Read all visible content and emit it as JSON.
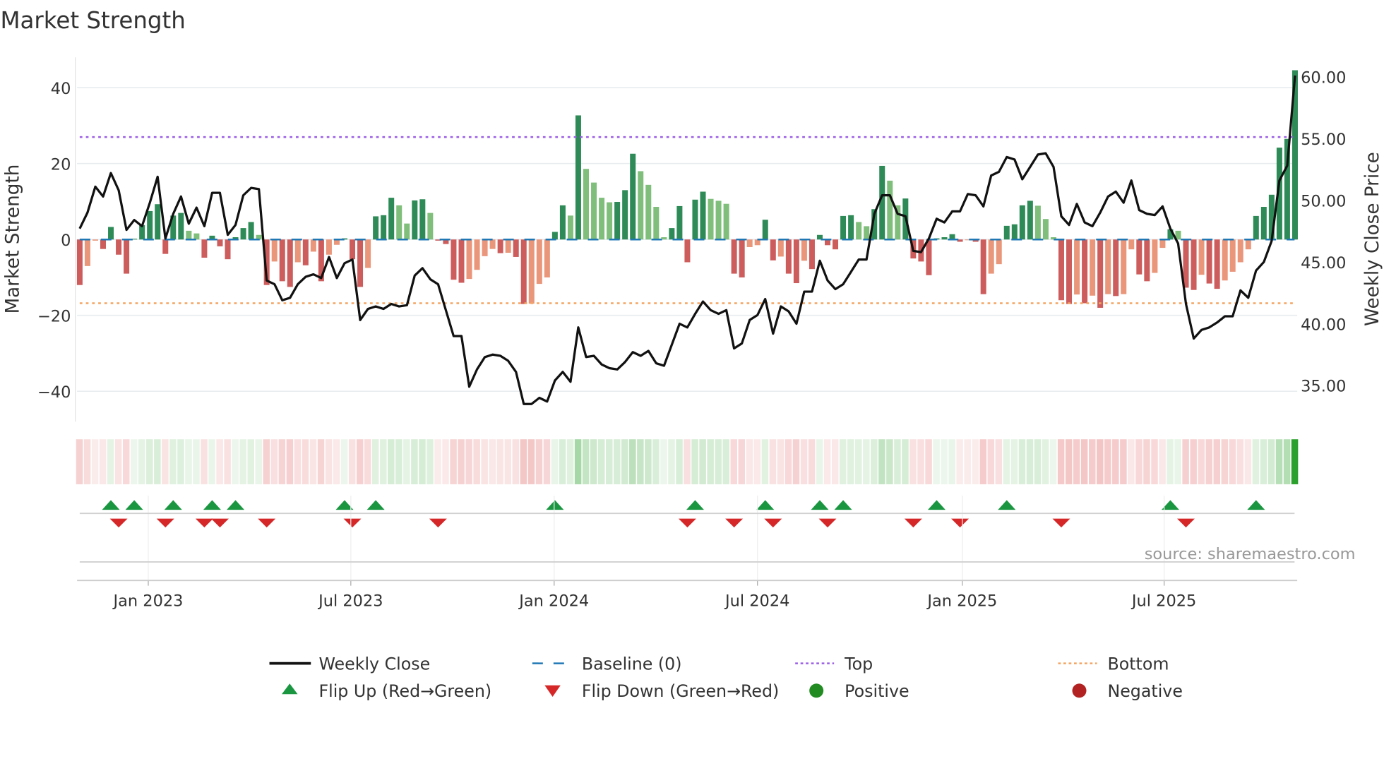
{
  "chart_data": {
    "type": "bar",
    "title": "Market Strength",
    "ylabel": "Market Strength",
    "ylabel_right": "Weekly Close Price",
    "ylim": [
      -48,
      48
    ],
    "ylim_right": [
      32.07,
      61.57
    ],
    "yticks": [
      {
        "value": 40,
        "label": "40"
      },
      {
        "value": 20,
        "label": "20"
      },
      {
        "value": 0,
        "label": "0"
      },
      {
        "value": -20,
        "label": "−20"
      },
      {
        "value": -40,
        "label": "−40"
      }
    ],
    "yticks_right": [
      {
        "value": 60,
        "label": "60.00"
      },
      {
        "value": 55,
        "label": "55.00"
      },
      {
        "value": 50,
        "label": "50.00"
      },
      {
        "value": 45,
        "label": "45.00"
      },
      {
        "value": 40,
        "label": "40.00"
      },
      {
        "value": 35,
        "label": "35.00"
      }
    ],
    "x_unit": "week index",
    "xticks": [
      {
        "week": 8.8,
        "label": "Jan 2023"
      },
      {
        "week": 34.8,
        "label": "Jul 2023"
      },
      {
        "week": 60.9,
        "label": "Jan 2024"
      },
      {
        "week": 87.0,
        "label": "Jul 2024"
      },
      {
        "week": 113.3,
        "label": "Jan 2025"
      },
      {
        "week": 139.2,
        "label": "Jul 2025"
      }
    ],
    "top_level": 27,
    "bottom_level": -16.8,
    "baseline": 0,
    "strength": [
      -12,
      -7,
      -0.3,
      -2.5,
      3.3,
      -4,
      -9,
      0.2,
      3.8,
      7.5,
      9.3,
      -3.8,
      6.3,
      7,
      2.3,
      1.6,
      -4.8,
      1,
      -1.8,
      -5.2,
      0.6,
      3,
      4.6,
      1.2,
      -12,
      -5.8,
      -11,
      -12.5,
      -6,
      -6.8,
      -3.2,
      -11,
      -4,
      -1.4,
      0.3,
      -5.2,
      -12.5,
      -7.5,
      6.1,
      6.4,
      11,
      9,
      4.2,
      10.3,
      10.6,
      7,
      -0.3,
      -1.2,
      -10.6,
      -11.4,
      -10.4,
      -8,
      -4.4,
      -2.5,
      -3.6,
      -3.5,
      -4.6,
      -17,
      -16.9,
      -11.7,
      -10,
      2,
      9,
      6.3,
      32.7,
      18.6,
      15,
      11,
      9.8,
      9.9,
      13,
      22.6,
      18,
      14.4,
      8.6,
      0.6,
      3,
      8.8,
      -6,
      10.5,
      12.6,
      10.7,
      10.2,
      9.4,
      -9,
      -10,
      -2,
      -1.5,
      5.2,
      -5.5,
      -4.5,
      -9,
      -11.5,
      -5.6,
      -7.8,
      1.2,
      -1.5,
      -2.6,
      6.2,
      6.4,
      4.6,
      3.5,
      8,
      19.4,
      15.5,
      9,
      10.8,
      -5,
      -5.8,
      -9.4,
      0.3,
      0.6,
      1.4,
      -0.6,
      -0.2,
      -0.6,
      -14.4,
      -9,
      -6.5,
      3.6,
      4,
      9,
      10.2,
      8.9,
      5.4,
      0.6,
      -16,
      -17,
      -14.5,
      -16.8,
      -14.8,
      -18,
      -14.4,
      -14.9,
      -14.4,
      -2.6,
      -9.2,
      -11,
      -8.8,
      -2.2,
      2.7,
      2.3,
      -12.7,
      -13.3,
      -9.3,
      -11.6,
      -13,
      -10.8,
      -8.5,
      -6,
      -2.6,
      6.2,
      8.6,
      11.8,
      24.2,
      26.5,
      44.6
    ],
    "weekly_close": [
      47.7,
      49.0,
      51.1,
      50.3,
      52.2,
      50.8,
      47.6,
      48.4,
      47.9,
      49.8,
      51.9,
      46.9,
      48.9,
      50.3,
      48.1,
      49.4,
      47.9,
      50.6,
      50.6,
      47.2,
      48.0,
      50.4,
      51.0,
      50.9,
      43.5,
      43.2,
      41.9,
      42.1,
      43.2,
      43.8,
      44.0,
      43.7,
      45.4,
      43.7,
      44.9,
      45.2,
      40.3,
      41.2,
      41.4,
      41.2,
      41.6,
      41.4,
      41.5,
      43.9,
      44.5,
      43.6,
      43.2,
      41.1,
      39.0,
      39.0,
      34.9,
      36.3,
      37.3,
      37.5,
      37.4,
      37.0,
      36.1,
      33.5,
      33.5,
      34.0,
      33.7,
      35.4,
      36.1,
      35.3,
      39.7,
      37.3,
      37.4,
      36.7,
      36.4,
      36.3,
      36.9,
      37.7,
      37.4,
      37.8,
      36.8,
      36.6,
      38.3,
      40.0,
      39.7,
      40.8,
      41.8,
      41.1,
      40.8,
      41.1,
      38.0,
      38.4,
      40.3,
      40.7,
      42.0,
      39.2,
      41.4,
      41.0,
      40.0,
      42.6,
      42.6,
      45.1,
      43.5,
      42.8,
      43.2,
      44.2,
      45.2,
      45.2,
      48.9,
      50.4,
      50.4,
      48.9,
      48.7,
      45.9,
      45.8,
      46.9,
      48.5,
      48.2,
      49.1,
      49.1,
      50.5,
      50.4,
      49.5,
      52.0,
      52.3,
      53.5,
      53.3,
      51.7,
      52.7,
      53.7,
      53.8,
      52.7,
      48.7,
      48.0,
      49.7,
      48.2,
      47.9,
      49.0,
      50.3,
      50.7,
      49.8,
      51.6,
      49.2,
      48.9,
      48.8,
      49.5,
      47.7,
      46.5,
      41.6,
      38.8,
      39.5,
      39.7,
      40.1,
      40.6,
      40.6,
      42.7,
      42.1,
      44.3,
      45.0,
      46.7,
      51.6,
      52.8,
      60.1
    ],
    "legend": [
      {
        "key": "close",
        "label": "Weekly Close"
      },
      {
        "key": "baseline",
        "label": "Baseline (0)"
      },
      {
        "key": "top",
        "label": "Top"
      },
      {
        "key": "bottom",
        "label": "Bottom"
      },
      {
        "key": "flip_up",
        "label": "Flip Up (Red→Green)"
      },
      {
        "key": "flip_down",
        "label": "Flip Down (Green→Red)"
      },
      {
        "key": "positive",
        "label": "Positive"
      },
      {
        "key": "negative",
        "label": "Negative"
      }
    ],
    "legend_placement": "bottom",
    "source": "source: sharemaestro.com",
    "colors": {
      "pos_strong": "#2e8b57",
      "pos_weak": "#7fbf7b",
      "neg_strong": "#cd5c5c",
      "neg_weak": "#e9967a",
      "close": "#111111",
      "baseline": "#1f77b4",
      "top": "#9b5de5",
      "bottom": "#f4a460",
      "flip_up": "#1a9641",
      "flip_down": "#d62728",
      "positive": "#228b22",
      "negative": "#b22222",
      "strip_pos": "#2ca02c",
      "strip_neg": "#d62728"
    }
  }
}
